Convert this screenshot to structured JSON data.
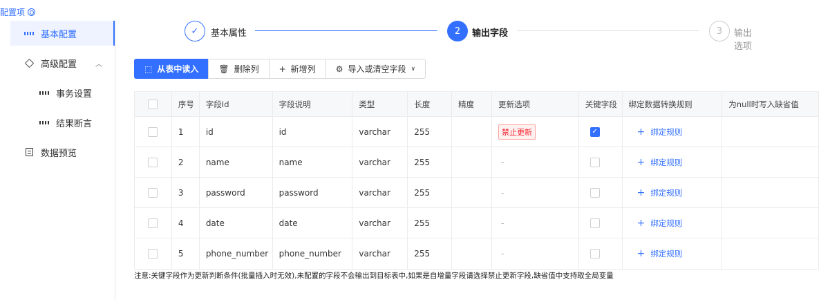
{
  "header": {
    "title": "配置项",
    "icon": "gear-icon"
  },
  "sidebar": {
    "items": [
      {
        "label": "基本配置",
        "icon": "grid-icon",
        "active": true
      },
      {
        "label": "高级配置",
        "icon": "cube-icon",
        "expanded": true
      },
      {
        "label": "事务设置",
        "icon": "grid-icon"
      },
      {
        "label": "结果断言",
        "icon": "grid-icon"
      },
      {
        "label": "数据预览",
        "icon": "doc-icon"
      }
    ]
  },
  "steps": [
    {
      "label": "基本属性",
      "status": "finish",
      "marker": "✓"
    },
    {
      "label": "输出字段",
      "status": "process",
      "marker": "2"
    },
    {
      "label": "输出选项",
      "status": "wait",
      "marker": "3"
    }
  ],
  "toolbar": {
    "read_from_table": "从表中读入",
    "delete_column": "删除列",
    "add_column": "新增列",
    "import_or_clear": "导入或清空字段"
  },
  "table": {
    "columns": [
      "序号",
      "字段Id",
      "字段说明",
      "类型",
      "长度",
      "精度",
      "更新选项",
      "关键字段",
      "绑定数据转换规则",
      "为null时写入缺省值"
    ],
    "rows": [
      {
        "index": "1",
        "field_id": "id",
        "field_desc": "id",
        "type": "varchar",
        "length": "255",
        "precision": "",
        "update_option": "禁止更新",
        "key_field": true,
        "bind_rule": "绑定规则",
        "default_value": ""
      },
      {
        "index": "2",
        "field_id": "name",
        "field_desc": "name",
        "type": "varchar",
        "length": "255",
        "precision": "",
        "update_option": "-",
        "key_field": false,
        "bind_rule": "绑定规则",
        "default_value": ""
      },
      {
        "index": "3",
        "field_id": "password",
        "field_desc": "password",
        "type": "varchar",
        "length": "255",
        "precision": "",
        "update_option": "-",
        "key_field": false,
        "bind_rule": "绑定规则",
        "default_value": ""
      },
      {
        "index": "4",
        "field_id": "date",
        "field_desc": "date",
        "type": "varchar",
        "length": "255",
        "precision": "",
        "update_option": "-",
        "key_field": false,
        "bind_rule": "绑定规则",
        "default_value": ""
      },
      {
        "index": "5",
        "field_id": "phone_number",
        "field_desc": "phone_number",
        "type": "varchar",
        "length": "255",
        "precision": "",
        "update_option": "-",
        "key_field": false,
        "bind_rule": "绑定规则",
        "default_value": ""
      }
    ]
  },
  "note": "注意:关键字段作为更新判断条件(批量插入时无效),未配置的字段不会输出到目标表中,如果是自增量字段请选择禁止更新字段,缺省值中支持取全局变量",
  "colors": {
    "primary": "#3370ff",
    "danger": "#f5222d",
    "border": "#ebebeb"
  }
}
